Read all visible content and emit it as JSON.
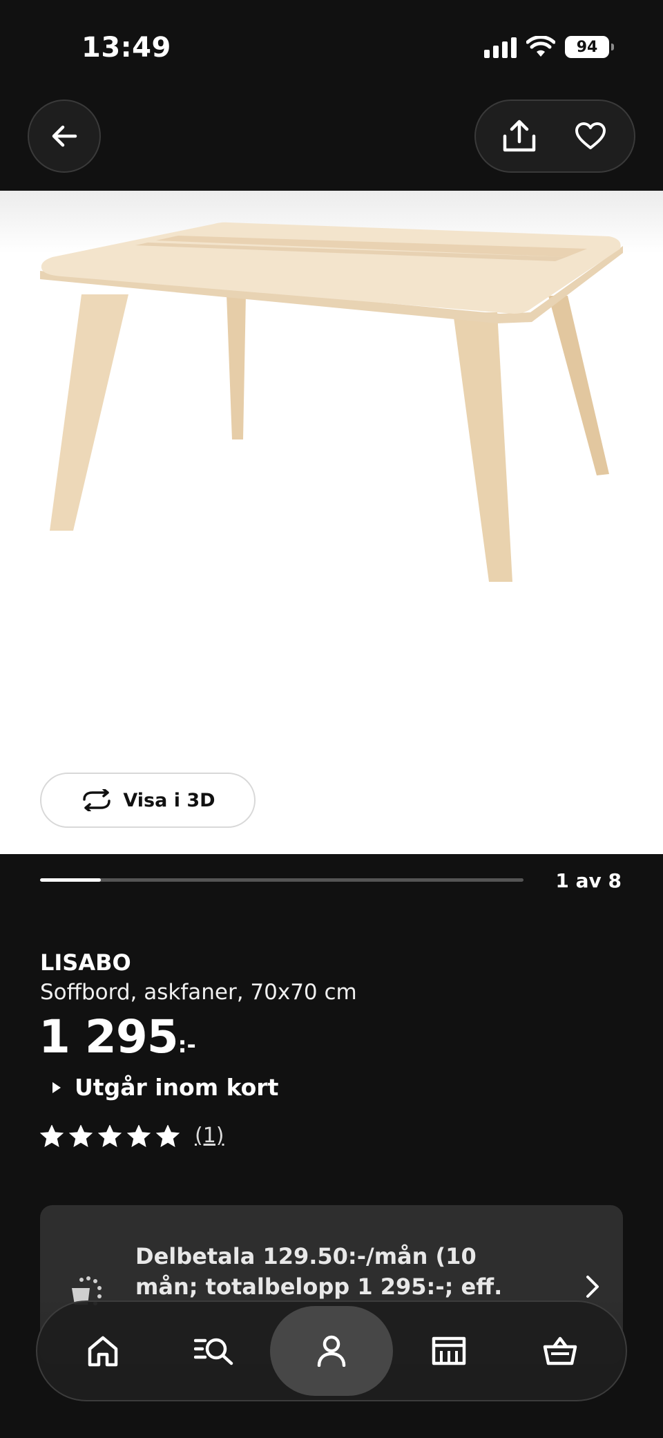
{
  "status_bar": {
    "time": "13:49",
    "battery": "94"
  },
  "nav": {
    "back_icon": "arrow-left-icon",
    "share_icon": "share-icon",
    "favorite_icon": "heart-icon"
  },
  "gallery": {
    "view_3d_label": "Visa i 3D",
    "counter": "1 av 8",
    "current_image": 1,
    "total_images": 8
  },
  "product": {
    "name": "LISABO",
    "description": "Soffbord, askfaner, 70x70 cm",
    "price": "1 295",
    "price_suffix": ":-",
    "notice": "Utgår inom kort",
    "rating_value": 5,
    "rating_max": 5,
    "review_count": "(1)"
  },
  "payment": {
    "text": "Delbetala 129.50:-/mån (10 mån; totalbelopp 1 295:-; eff."
  },
  "tab_bar": {
    "items": [
      {
        "icon": "home-icon",
        "active": false
      },
      {
        "icon": "search-list-icon",
        "active": false
      },
      {
        "icon": "person-icon",
        "active": true
      },
      {
        "icon": "store-icon",
        "active": false
      },
      {
        "icon": "basket-icon",
        "active": false
      }
    ]
  },
  "colors": {
    "background": "#111111",
    "card": "#2e2e2e",
    "text": "#ffffff",
    "image_background": "#ffffff"
  }
}
